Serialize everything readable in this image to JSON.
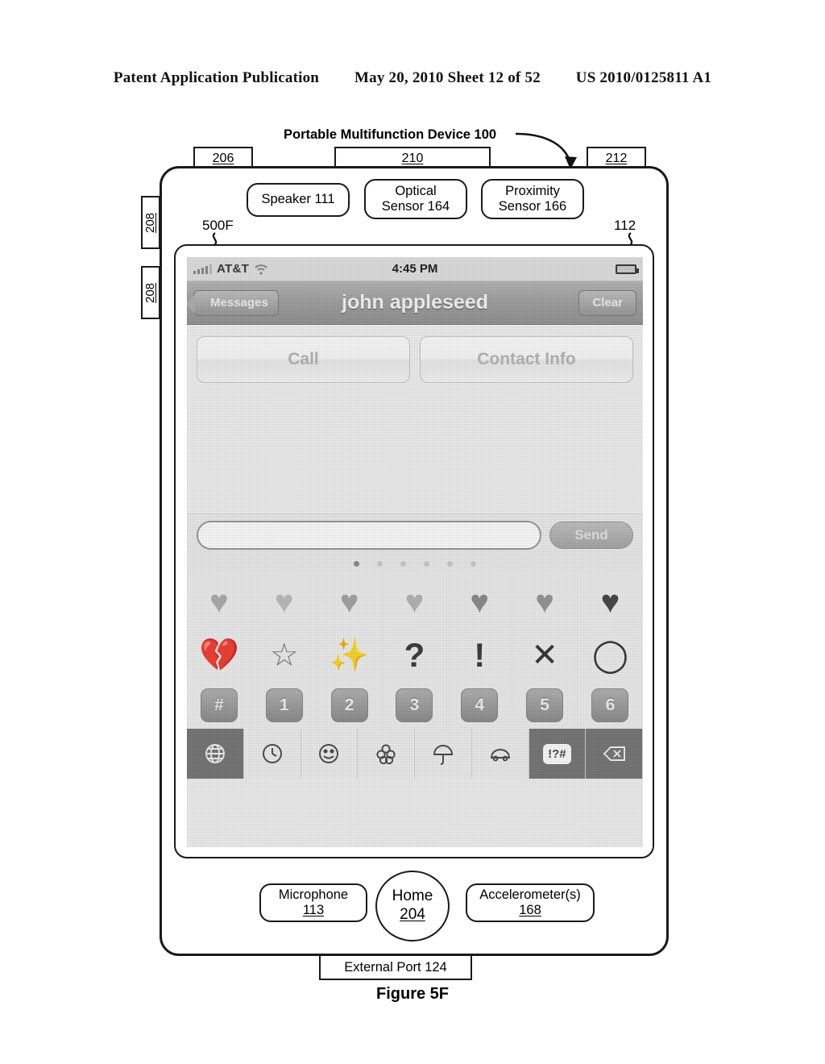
{
  "publication": {
    "left": "Patent Application Publication",
    "date_sheet": "May 20, 2010  Sheet 12 of 52",
    "number": "US 2010/0125811 A1"
  },
  "figure": {
    "device_title": "Portable Multifunction Device 100",
    "caption": "Figure 5F",
    "screen_ref": "500F",
    "touchscreen_ref": "112",
    "external_port": "External Port 124"
  },
  "hardware": {
    "tab_206": "206",
    "tab_210": "210",
    "tab_212": "212",
    "side_button_a": "208",
    "side_button_b": "208",
    "speaker_line1": "Speaker 111",
    "optical_line1": "Optical",
    "optical_line2": "Sensor 164",
    "proximity_line1": "Proximity",
    "proximity_line2": "Sensor 166",
    "microphone_line1": "Microphone",
    "microphone_line2": "113",
    "home_line1": "Home",
    "home_line2": "204",
    "accelerometer_line1": "Accelerometer(s)",
    "accelerometer_line2": "168"
  },
  "status_bar": {
    "carrier": "AT&T",
    "time": "4:45 PM",
    "signal_icon": "signal-bars-icon",
    "wifi_icon": "wifi-icon",
    "battery_icon": "battery-icon"
  },
  "nav_bar": {
    "back_label": "Messages",
    "title": "john appleseed",
    "clear_label": "Clear"
  },
  "actions": {
    "call_label": "Call",
    "contact_info_label": "Contact Info"
  },
  "compose": {
    "field_value": "",
    "field_placeholder": "",
    "send_label": "Send"
  },
  "page_dots": {
    "count": 6,
    "active_index": 0
  },
  "emoji_keyboard": {
    "row1": [
      {
        "name": "heart-icon-1",
        "glyph": "♥",
        "shade": "#b0b0b0"
      },
      {
        "name": "heart-icon-2",
        "glyph": "♥",
        "shade": "#c0c0c0"
      },
      {
        "name": "heart-icon-3",
        "glyph": "♥",
        "shade": "#a8a8a8"
      },
      {
        "name": "heart-icon-4",
        "glyph": "♥",
        "shade": "#b8b8b8"
      },
      {
        "name": "heart-icon-5",
        "glyph": "♥",
        "shade": "#8f8f8f"
      },
      {
        "name": "heart-with-arrow-icon",
        "glyph": "♥",
        "shade": "#9a9a9a"
      },
      {
        "name": "heart-icon-solid",
        "glyph": "♥",
        "shade": "#4a4a4a"
      }
    ],
    "row2": [
      {
        "name": "broken-heart-icon",
        "glyph": "💔",
        "shade": "#3f3f3f"
      },
      {
        "name": "star-icon",
        "glyph": "☆",
        "shade": "#7a7a7a"
      },
      {
        "name": "sparkles-icon",
        "glyph": "✨",
        "shade": "#9a9a9a"
      },
      {
        "name": "question-mark-icon",
        "glyph": "?",
        "shade": "#3f3f3f"
      },
      {
        "name": "exclamation-mark-icon",
        "glyph": "!",
        "shade": "#3f3f3f"
      },
      {
        "name": "cross-mark-icon",
        "glyph": "✕",
        "shade": "#3a3a3a"
      },
      {
        "name": "circle-mark-icon",
        "glyph": "◯",
        "shade": "#3a3a3a"
      }
    ],
    "row3": [
      {
        "name": "key-hash",
        "label": "#"
      },
      {
        "name": "key-1",
        "label": "1"
      },
      {
        "name": "key-2",
        "label": "2"
      },
      {
        "name": "key-3",
        "label": "3"
      },
      {
        "name": "key-4",
        "label": "4"
      },
      {
        "name": "key-5",
        "label": "5"
      },
      {
        "name": "key-6",
        "label": "6"
      }
    ],
    "toolbar": [
      {
        "name": "globe-icon",
        "dark": true
      },
      {
        "name": "clock-icon",
        "dark": false
      },
      {
        "name": "smiley-face-icon",
        "dark": false
      },
      {
        "name": "flower-icon",
        "dark": false
      },
      {
        "name": "umbrella-icon",
        "dark": false
      },
      {
        "name": "car-icon",
        "dark": false
      },
      {
        "name": "symbols-icon",
        "dark": true,
        "label": "!?#"
      },
      {
        "name": "backspace-delete-icon",
        "dark": true
      }
    ]
  },
  "colors": {
    "ink": "#1a1a1a",
    "screen_bg": "#f2f2f2",
    "navbar_gray": "#a3a3a3",
    "key_gray": "#8f8f8f"
  }
}
